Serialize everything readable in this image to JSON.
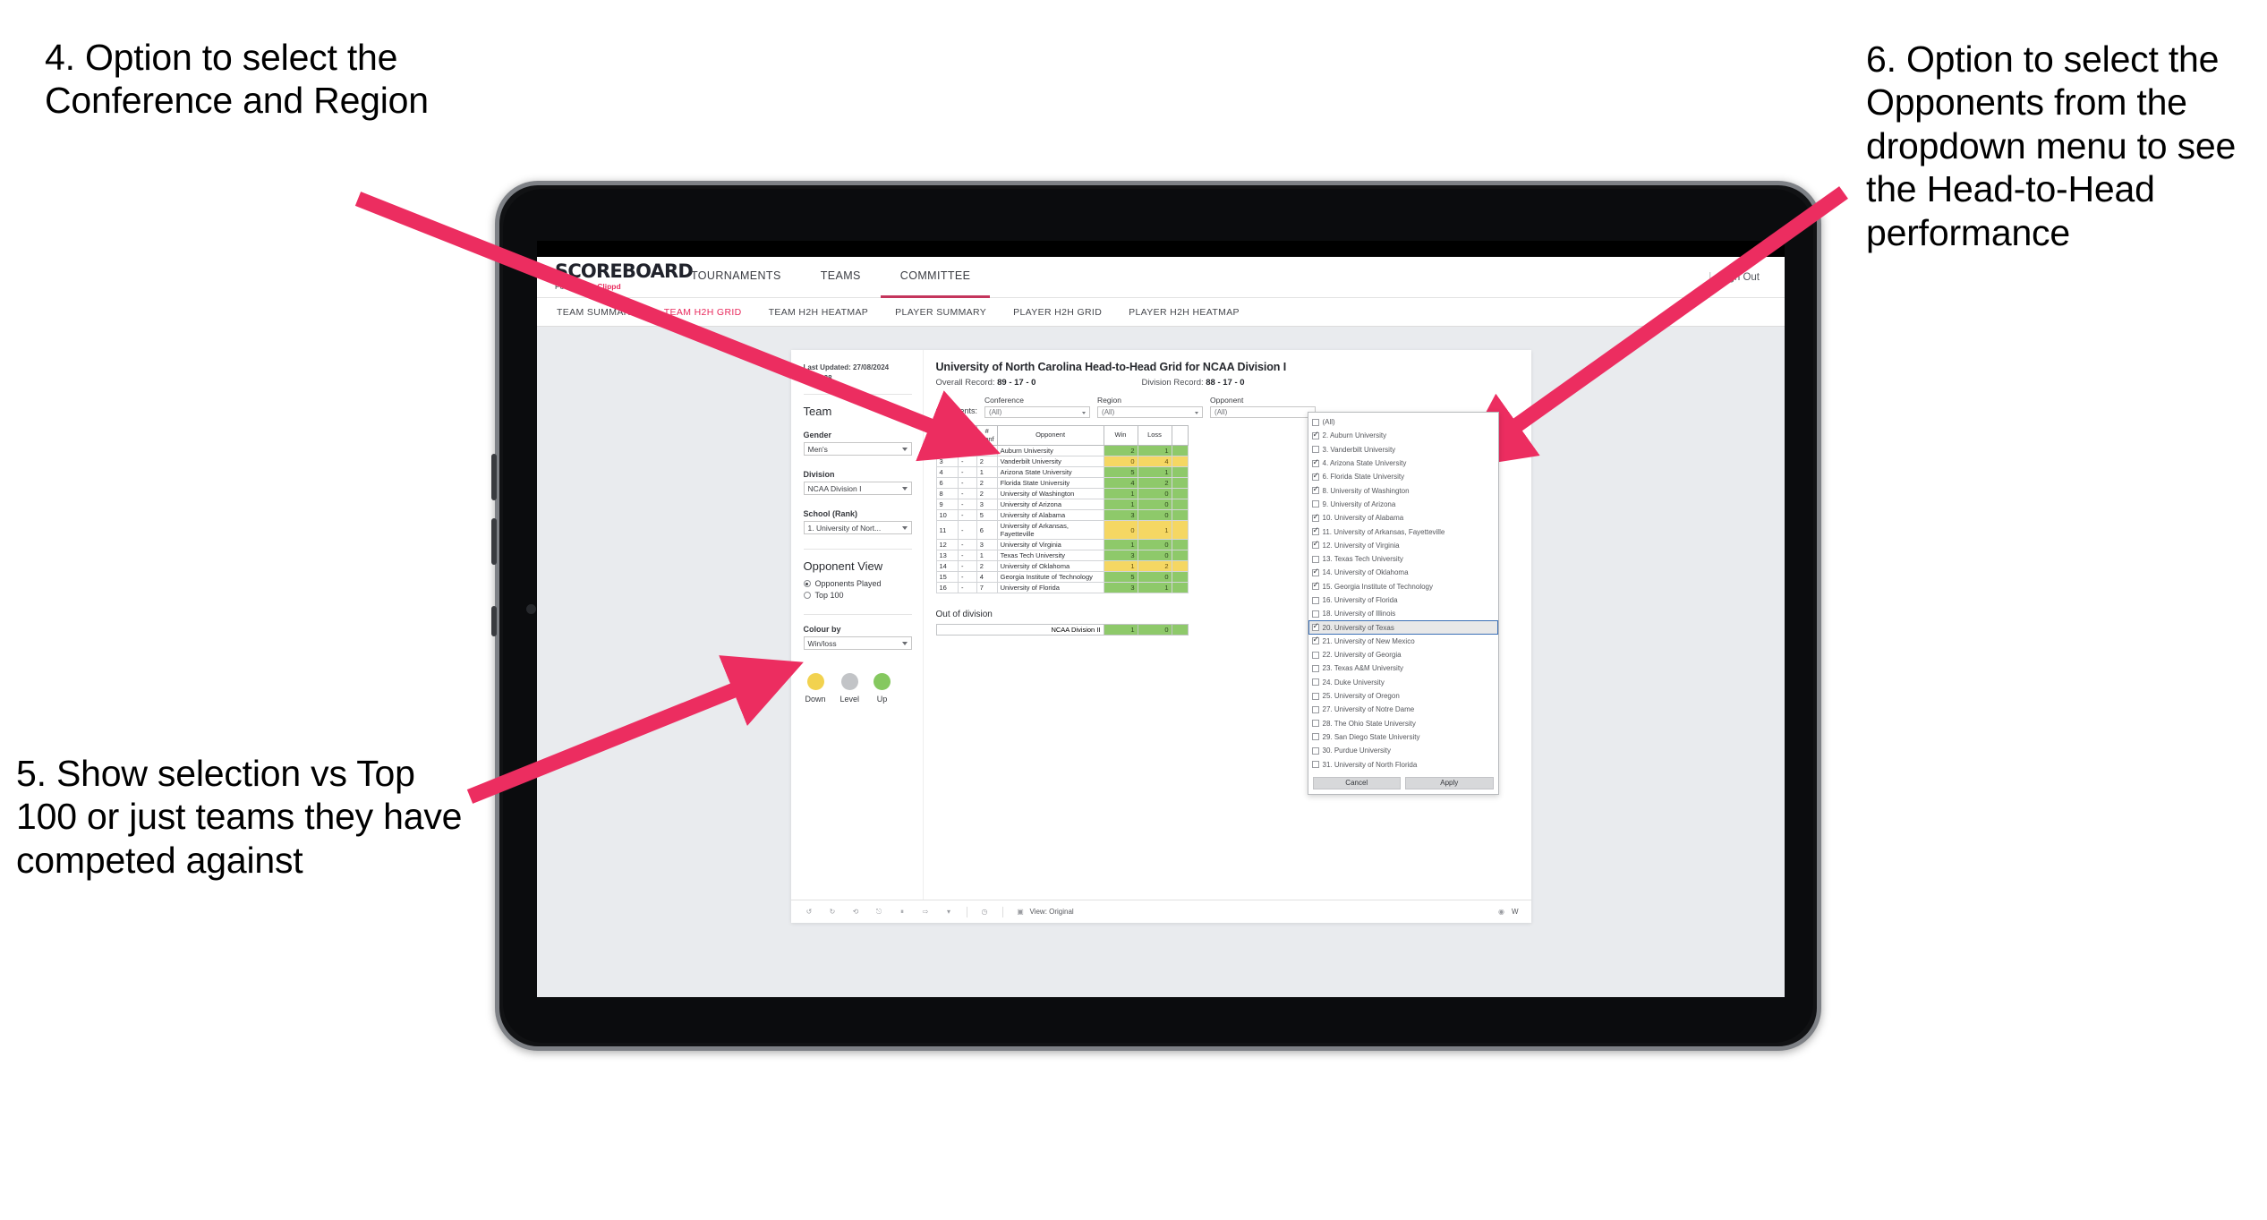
{
  "annotations": {
    "a4": "4. Option to select the Conference and Region",
    "a5": "5. Show selection vs Top 100 or just teams they have competed against",
    "a6": "6. Option to select the Opponents from the dropdown menu to see the Head-to-Head performance",
    "arrow_color": "#ec2d60"
  },
  "site": {
    "logo_main": "SCOREBOARD",
    "logo_sub_prefix": "Powered by ",
    "logo_sub_accent": "Clippd",
    "top_nav": [
      {
        "label": "TOURNAMENTS",
        "active": false
      },
      {
        "label": "TEAMS",
        "active": false
      },
      {
        "label": "COMMITTEE",
        "active": true
      }
    ],
    "signout": "Sign Out",
    "signout_divider": "|",
    "sub_nav": [
      {
        "label": "TEAM SUMMARY",
        "active": false
      },
      {
        "label": "TEAM H2H GRID",
        "active": true
      },
      {
        "label": "TEAM H2H HEATMAP",
        "active": false
      },
      {
        "label": "PLAYER SUMMARY",
        "active": false
      },
      {
        "label": "PLAYER H2H GRID",
        "active": false
      },
      {
        "label": "PLAYER H2H HEATMAP",
        "active": false
      }
    ]
  },
  "sidebar": {
    "last_updated": "Last Updated: 27/08/2024 16:55:38",
    "team_heading": "Team",
    "fields": [
      {
        "label": "Gender",
        "value": "Men's"
      },
      {
        "label": "Division",
        "value": "NCAA Division I"
      },
      {
        "label": "School (Rank)",
        "value": "1. University of Nort..."
      }
    ],
    "opponent_view_heading": "Opponent View",
    "radios": [
      {
        "label": "Opponents Played",
        "selected": true
      },
      {
        "label": "Top 100",
        "selected": false
      }
    ],
    "colour_by_label": "Colour by",
    "colour_by_value": "Win/loss",
    "legend": [
      {
        "label": "Down",
        "color": "#f2d24f"
      },
      {
        "label": "Level",
        "color": "#c2c4c7"
      },
      {
        "label": "Up",
        "color": "#85c85f"
      }
    ]
  },
  "main": {
    "title": "University of North Carolina Head-to-Head Grid for NCAA Division I",
    "overall_record_label": "Overall Record: ",
    "overall_record_value": "89 - 17 - 0",
    "division_record_label": "Division Record: ",
    "division_record_value": "88 - 17 - 0",
    "opponents_label": "Opponents:",
    "filters": [
      {
        "caption": "Conference",
        "value": "(All)"
      },
      {
        "caption": "Region",
        "value": "(All)"
      },
      {
        "caption": "Opponent",
        "value": "(All)"
      }
    ],
    "out_of_division_title": "Out of division"
  },
  "chart_data": {
    "type": "table",
    "title": "University of North Carolina Head-to-Head Grid for NCAA Division I",
    "columns": [
      "# Rank",
      "# Reg",
      "# Conf",
      "Opponent",
      "Win",
      "Loss",
      ""
    ],
    "rows": [
      {
        "rank": "2",
        "reg": "-",
        "conf": "1",
        "opponent": "Auburn University",
        "win": "2",
        "loss": "1",
        "state": "up"
      },
      {
        "rank": "3",
        "reg": "-",
        "conf": "2",
        "opponent": "Vanderbilt University",
        "win": "0",
        "loss": "4",
        "state": "down"
      },
      {
        "rank": "4",
        "reg": "-",
        "conf": "1",
        "opponent": "Arizona State University",
        "win": "5",
        "loss": "1",
        "state": "up"
      },
      {
        "rank": "6",
        "reg": "-",
        "conf": "2",
        "opponent": "Florida State University",
        "win": "4",
        "loss": "2",
        "state": "up"
      },
      {
        "rank": "8",
        "reg": "-",
        "conf": "2",
        "opponent": "University of Washington",
        "win": "1",
        "loss": "0",
        "state": "up"
      },
      {
        "rank": "9",
        "reg": "-",
        "conf": "3",
        "opponent": "University of Arizona",
        "win": "1",
        "loss": "0",
        "state": "up"
      },
      {
        "rank": "10",
        "reg": "-",
        "conf": "5",
        "opponent": "University of Alabama",
        "win": "3",
        "loss": "0",
        "state": "up"
      },
      {
        "rank": "11",
        "reg": "-",
        "conf": "6",
        "opponent": "University of Arkansas, Fayetteville",
        "win": "0",
        "loss": "1",
        "state": "down"
      },
      {
        "rank": "12",
        "reg": "-",
        "conf": "3",
        "opponent": "University of Virginia",
        "win": "1",
        "loss": "0",
        "state": "up"
      },
      {
        "rank": "13",
        "reg": "-",
        "conf": "1",
        "opponent": "Texas Tech University",
        "win": "3",
        "loss": "0",
        "state": "up"
      },
      {
        "rank": "14",
        "reg": "-",
        "conf": "2",
        "opponent": "University of Oklahoma",
        "win": "1",
        "loss": "2",
        "state": "down"
      },
      {
        "rank": "15",
        "reg": "-",
        "conf": "4",
        "opponent": "Georgia Institute of Technology",
        "win": "5",
        "loss": "0",
        "state": "up"
      },
      {
        "rank": "16",
        "reg": "-",
        "conf": "7",
        "opponent": "University of Florida",
        "win": "3",
        "loss": "1",
        "state": "up"
      }
    ],
    "out_of_division": {
      "name": "NCAA Division II",
      "win": "1",
      "loss": "0",
      "state": "up"
    },
    "colors": {
      "up": "#8ec96a",
      "down": "#f5d763",
      "level": "#c2c4c7"
    }
  },
  "opponent_dropdown": {
    "options": [
      {
        "label": "(All)",
        "checked": false,
        "highlighted": false
      },
      {
        "label": "2. Auburn University",
        "checked": true,
        "highlighted": false
      },
      {
        "label": "3. Vanderbilt University",
        "checked": false,
        "highlighted": false
      },
      {
        "label": "4. Arizona State University",
        "checked": true,
        "highlighted": false
      },
      {
        "label": "6. Florida State University",
        "checked": true,
        "highlighted": false
      },
      {
        "label": "8. University of Washington",
        "checked": true,
        "highlighted": false
      },
      {
        "label": "9. University of Arizona",
        "checked": false,
        "highlighted": false
      },
      {
        "label": "10. University of Alabama",
        "checked": true,
        "highlighted": false
      },
      {
        "label": "11. University of Arkansas, Fayetteville",
        "checked": true,
        "highlighted": false
      },
      {
        "label": "12. University of Virginia",
        "checked": true,
        "highlighted": false
      },
      {
        "label": "13. Texas Tech University",
        "checked": false,
        "highlighted": false
      },
      {
        "label": "14. University of Oklahoma",
        "checked": true,
        "highlighted": false
      },
      {
        "label": "15. Georgia Institute of Technology",
        "checked": true,
        "highlighted": false
      },
      {
        "label": "16. University of Florida",
        "checked": false,
        "highlighted": false
      },
      {
        "label": "18. University of Illinois",
        "checked": false,
        "highlighted": false
      },
      {
        "label": "20. University of Texas",
        "checked": true,
        "highlighted": true
      },
      {
        "label": "21. University of New Mexico",
        "checked": true,
        "highlighted": false
      },
      {
        "label": "22. University of Georgia",
        "checked": false,
        "highlighted": false
      },
      {
        "label": "23. Texas A&M University",
        "checked": false,
        "highlighted": false
      },
      {
        "label": "24. Duke University",
        "checked": false,
        "highlighted": false
      },
      {
        "label": "25. University of Oregon",
        "checked": false,
        "highlighted": false
      },
      {
        "label": "27. University of Notre Dame",
        "checked": false,
        "highlighted": false
      },
      {
        "label": "28. The Ohio State University",
        "checked": false,
        "highlighted": false
      },
      {
        "label": "29. San Diego State University",
        "checked": false,
        "highlighted": false
      },
      {
        "label": "30. Purdue University",
        "checked": false,
        "highlighted": false
      },
      {
        "label": "31. University of North Florida",
        "checked": false,
        "highlighted": false
      }
    ],
    "cancel_label": "Cancel",
    "apply_label": "Apply"
  },
  "toolbar": {
    "icons": [
      "undo-icon",
      "redo-icon",
      "revert-icon",
      "refresh-icon",
      "pause-icon",
      "share-icon",
      "chevron-down-icon",
      "alerts-icon"
    ],
    "view_label": "View: Original",
    "watch_label": "W"
  }
}
